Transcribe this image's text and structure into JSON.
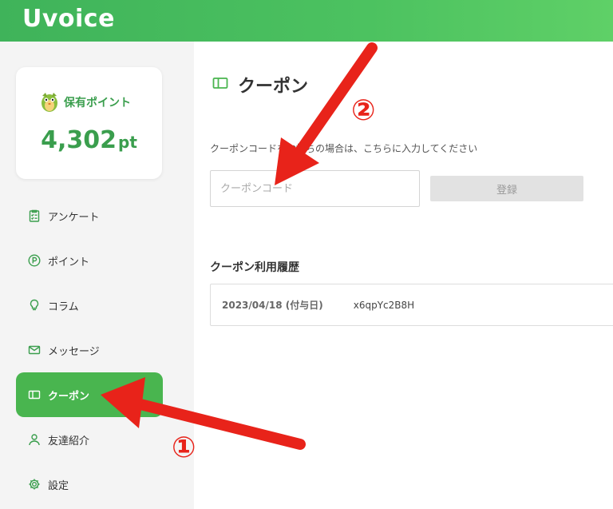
{
  "header": {
    "logo": "Uvoice"
  },
  "points": {
    "label": "保有ポイント",
    "value": "4,302",
    "unit": "pt"
  },
  "sidebar": {
    "items": [
      {
        "label": "アンケート",
        "icon": "survey-icon"
      },
      {
        "label": "ポイント",
        "icon": "point-icon"
      },
      {
        "label": "コラム",
        "icon": "bulb-icon"
      },
      {
        "label": "メッセージ",
        "icon": "mail-icon"
      },
      {
        "label": "クーポン",
        "icon": "coupon-icon",
        "active": true
      },
      {
        "label": "友達紹介",
        "icon": "person-icon"
      },
      {
        "label": "設定",
        "icon": "gear-icon"
      }
    ]
  },
  "main": {
    "title": "クーポン",
    "description": "クーポンコードをお持ちの場合は、こちらに入力してください",
    "input": {
      "placeholder": "クーポンコード",
      "value": ""
    },
    "register_label": "登録",
    "history": {
      "title": "クーポン利用履歴",
      "rows": [
        {
          "date": "2023/04/18 (付与日)",
          "code": "x6qpYc2B8H"
        }
      ]
    }
  },
  "annotations": {
    "step1": "①",
    "step2": "②",
    "arrow_color": "#e8231a"
  },
  "colors": {
    "brand": "#49b54f",
    "header": "#3fb35a",
    "accent_text": "#3a9e4d"
  }
}
